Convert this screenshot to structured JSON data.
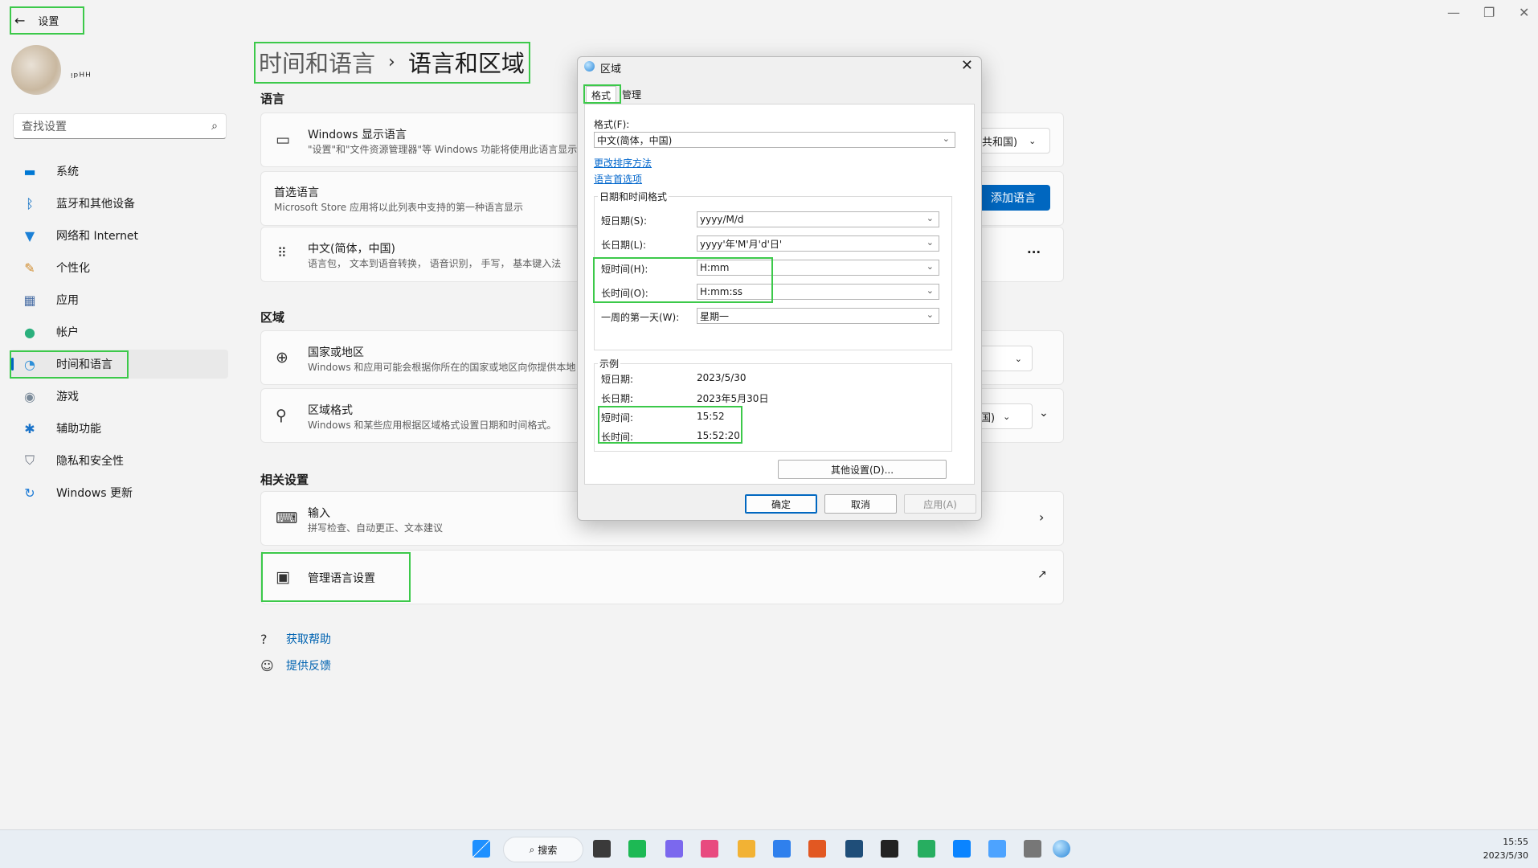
{
  "window": {
    "minimize_icon": "minimize-icon",
    "maximize_icon": "restore-icon",
    "close_icon": "close-icon"
  },
  "sidebar": {
    "back_title": "设置",
    "username": "ᵎᵖᴴᴴ",
    "search_placeholder": "查找设置",
    "items": [
      {
        "label": "系统",
        "icon": "▬",
        "color": "#0078d4"
      },
      {
        "label": "蓝牙和其他设备",
        "icon": "ᛒ",
        "color": "#0067c0"
      },
      {
        "label": "网络和 Internet",
        "icon": "▼",
        "color": "#1b80d6"
      },
      {
        "label": "个性化",
        "icon": "✎",
        "color": "#d08a2a"
      },
      {
        "label": "应用",
        "icon": "▦",
        "color": "#4a6fa5"
      },
      {
        "label": "帐户",
        "icon": "●",
        "color": "#2bb07d"
      },
      {
        "label": "时间和语言",
        "icon": "◔",
        "color": "#2d8fd8"
      },
      {
        "label": "游戏",
        "icon": "◉",
        "color": "#7a8a99"
      },
      {
        "label": "辅助功能",
        "icon": "✱",
        "color": "#1a73c9"
      },
      {
        "label": "隐私和安全性",
        "icon": "⛉",
        "color": "#6b7380"
      },
      {
        "label": "Windows 更新",
        "icon": "↻",
        "color": "#1f7cd6"
      }
    ]
  },
  "breadcrumb": {
    "parent": "时间和语言",
    "current": "语言和区域"
  },
  "sections": {
    "language": "语言",
    "region": "区域",
    "related": "相关设置"
  },
  "cards": {
    "display_lang": {
      "title": "Windows 显示语言",
      "subtitle": "\"设置\"和\"文件资源管理器\"等 Windows 功能将使用此语言显示。",
      "value": "共和国)"
    },
    "preferred_lang": {
      "title": "首选语言",
      "subtitle": "Microsoft Store 应用将以此列表中支持的第一种语言显示",
      "button": "添加语言"
    },
    "chinese": {
      "title": "中文(简体，中国)",
      "subtitle": "语言包， 文本到语音转换， 语音识别， 手写， 基本键入法",
      "more": "···"
    },
    "country": {
      "title": "国家或地区",
      "subtitle": "Windows 和应用可能会根据你所在的国家或地区向你提供本地"
    },
    "regional_format": {
      "title": "区域格式",
      "subtitle": "Windows 和某些应用根据区域格式设置日期和时间格式。",
      "value": "国)"
    },
    "input": {
      "title": "输入",
      "subtitle": "拼写检查、自动更正、文本建议"
    },
    "manage_lang": {
      "title": "管理语言设置"
    }
  },
  "links": {
    "help": "获取帮助",
    "feedback": "提供反馈"
  },
  "dialog": {
    "title": "区域",
    "tabs": [
      "格式",
      "管理"
    ],
    "format_label": "格式(F):",
    "format_value": "中文(简体，中国)",
    "link_sort": "更改排序方法",
    "link_lang_pref": "语言首选项",
    "datetime_group": "日期和时间格式",
    "rows": [
      {
        "label": "短日期(S):",
        "value": "yyyy/M/d"
      },
      {
        "label": "长日期(L):",
        "value": "yyyy'年'M'月'd'日'"
      },
      {
        "label": "短时间(H):",
        "value": "H:mm"
      },
      {
        "label": "长时间(O):",
        "value": "H:mm:ss"
      },
      {
        "label": "一周的第一天(W):",
        "value": "星期一"
      }
    ],
    "example_group": "示例",
    "examples": [
      {
        "label": "短日期:",
        "value": "2023/5/30"
      },
      {
        "label": "长日期:",
        "value": "2023年5月30日"
      },
      {
        "label": "短时间:",
        "value": "15:52"
      },
      {
        "label": "长时间:",
        "value": "15:52:20"
      }
    ],
    "other_settings": "其他设置(D)...",
    "ok": "确定",
    "cancel": "取消",
    "apply": "应用(A)"
  },
  "taskbar": {
    "search": "搜索",
    "time": "15:55",
    "date": "2023/5/30"
  }
}
